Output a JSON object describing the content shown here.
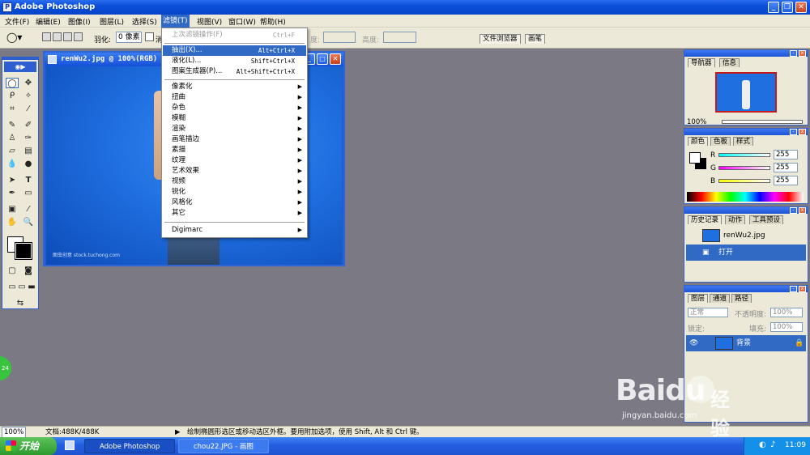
{
  "window": {
    "title": "Adobe Photoshop",
    "min": "_",
    "restore": "❐",
    "close": "✕"
  },
  "menubar": {
    "items": [
      {
        "label": "文件(F)"
      },
      {
        "label": "编辑(E)"
      },
      {
        "label": "图像(I)"
      },
      {
        "label": "图层(L)"
      },
      {
        "label": "选择(S)"
      },
      {
        "label": "滤镜(T)"
      },
      {
        "label": "视图(V)"
      },
      {
        "label": "窗口(W)"
      },
      {
        "label": "帮助(H)"
      }
    ]
  },
  "options": {
    "feather_label": "羽化:",
    "feather_value": "0 像素",
    "antialias_label": "消",
    "width_label": "度:",
    "height_label": "高度:",
    "file_browser_tab": "文件浏览器",
    "brushes_tab": "画笔"
  },
  "document": {
    "title": "renWu2.jpg @ 100%(RGB)",
    "watermark": "图虫创意 stock.tuchong.com"
  },
  "filter_menu": {
    "items": [
      {
        "label": "上次滤镜操作(F)",
        "shortcut": "Ctrl+F",
        "disabled": true
      },
      {
        "label": "抽出(X)...",
        "shortcut": "Alt+Ctrl+X",
        "highlight": true
      },
      {
        "label": "液化(L)...",
        "shortcut": "Shift+Ctrl+X"
      },
      {
        "label": "图案生成器(P)...",
        "shortcut": "Alt+Shift+Ctrl+X"
      },
      {
        "label": "像素化",
        "submenu": true
      },
      {
        "label": "扭曲",
        "submenu": true
      },
      {
        "label": "杂色",
        "submenu": true
      },
      {
        "label": "模糊",
        "submenu": true
      },
      {
        "label": "渲染",
        "submenu": true
      },
      {
        "label": "画笔描边",
        "submenu": true
      },
      {
        "label": "素描",
        "submenu": true
      },
      {
        "label": "纹理",
        "submenu": true
      },
      {
        "label": "艺术效果",
        "submenu": true
      },
      {
        "label": "视频",
        "submenu": true
      },
      {
        "label": "锐化",
        "submenu": true
      },
      {
        "label": "风格化",
        "submenu": true
      },
      {
        "label": "其它",
        "submenu": true
      },
      {
        "label": "Digimarc",
        "submenu": true
      }
    ]
  },
  "navigator": {
    "tab1": "导航器",
    "tab2": "信息",
    "zoom": "100%"
  },
  "color": {
    "tab1": "颜色",
    "tab2": "色板",
    "tab3": "样式",
    "r_label": "R",
    "g_label": "G",
    "b_label": "B",
    "r": "255",
    "g": "255",
    "b": "255"
  },
  "history": {
    "tab1": "历史记录",
    "tab2": "动作",
    "tab3": "工具预设",
    "snapshot": "renWu2.jpg",
    "step": "打开"
  },
  "layers": {
    "tab1": "图层",
    "tab2": "通道",
    "tab3": "路径",
    "blend_mode": "正常",
    "opacity_label": "不透明度:",
    "opacity": "100%",
    "lock_label": "锁定:",
    "fill_label": "填充:",
    "fill": "100%",
    "layer_name": "背景"
  },
  "status": {
    "zoom": "100%",
    "doc": "文档:488K/488K",
    "hint": "绘制椭圆形选区或移动选区外框。要用附加选项，使用 Shift, Alt 和 Ctrl 键。"
  },
  "taskbar": {
    "start": "开始",
    "task1": "Adobe Photoshop",
    "task2": "chou22.JPG - 画图",
    "time": "11:09"
  },
  "badge": "24",
  "baidu": {
    "logo": "Baidu",
    "cn": "经验",
    "url": "jingyan.baidu.com"
  },
  "colors": {
    "accent": "#316ac5",
    "titlebar": "#0a4fd9",
    "workspace": "#7b7984"
  }
}
